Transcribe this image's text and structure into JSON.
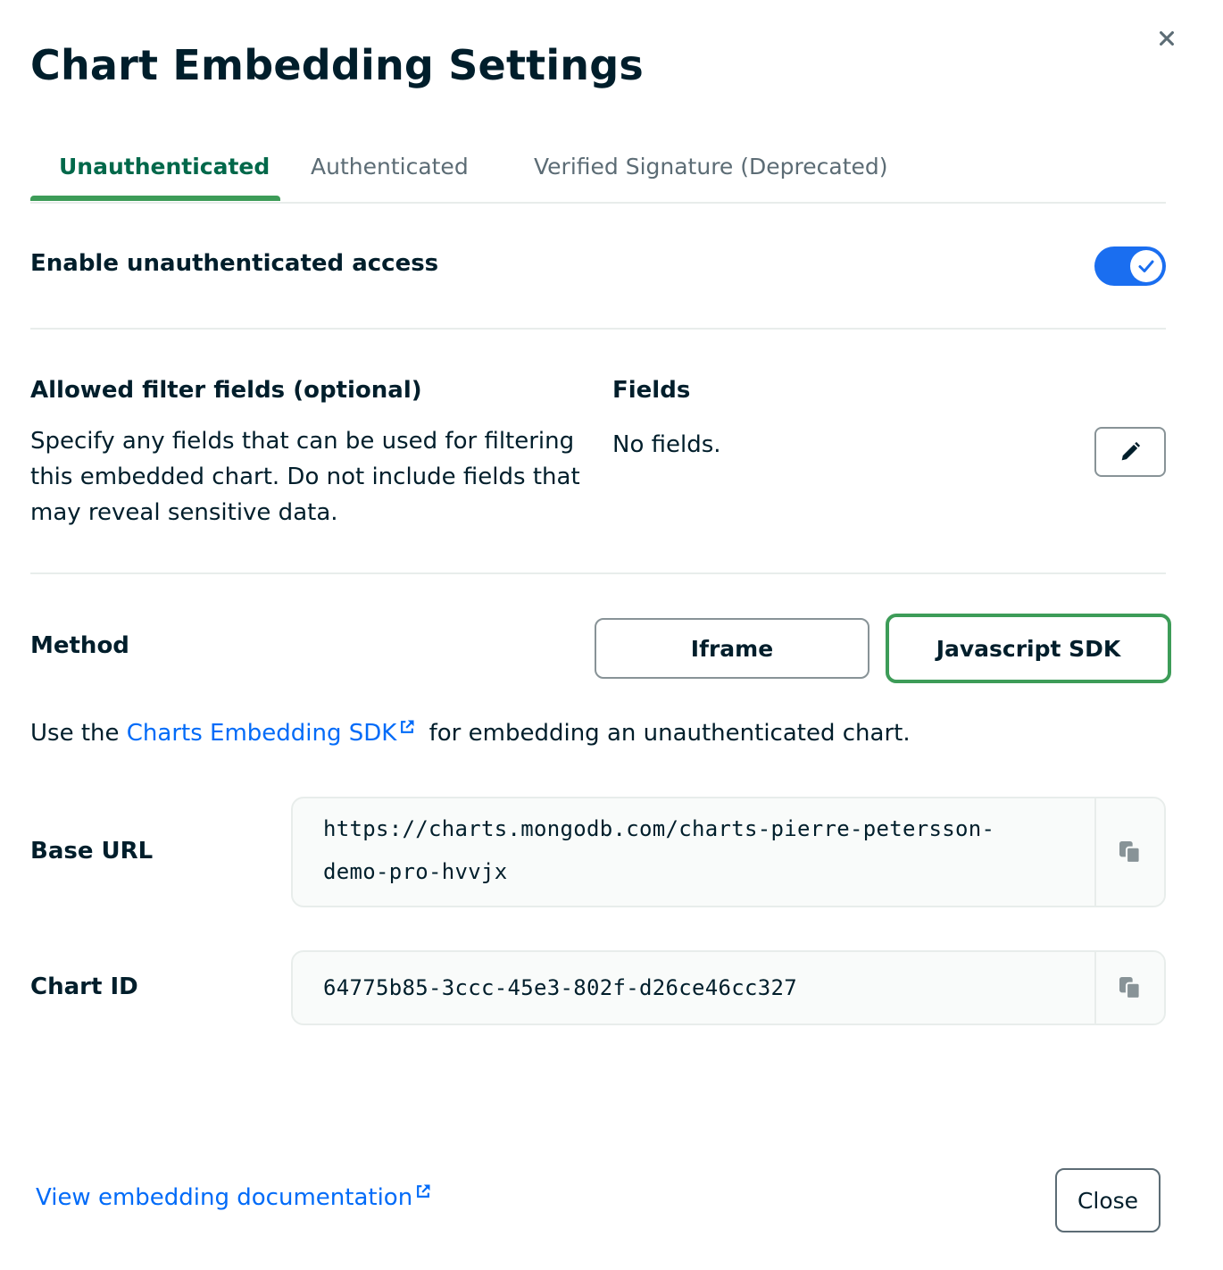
{
  "dialog": {
    "title": "Chart Embedding Settings",
    "close_icon": "close-icon"
  },
  "tabs": [
    {
      "label": "Unauthenticated",
      "active": true
    },
    {
      "label": "Authenticated",
      "active": false
    },
    {
      "label": "Verified Signature (Deprecated)",
      "active": false
    }
  ],
  "access": {
    "label": "Enable unauthenticated access",
    "enabled": true
  },
  "filters": {
    "heading": "Allowed filter fields (optional)",
    "description": "Specify any fields that can be used for filtering this embedded chart. Do not include fields that may reveal sensitive data.",
    "fields_heading": "Fields",
    "fields_value": "No fields.",
    "edit_icon": "pencil-icon"
  },
  "method": {
    "label": "Method",
    "options": [
      "Iframe",
      "Javascript SDK"
    ],
    "selected": "Javascript SDK"
  },
  "sdk_note": {
    "prefix": "Use the",
    "link": "Charts Embedding SDK",
    "suffix": "for embedding an unauthenticated chart."
  },
  "base_url": {
    "label": "Base URL",
    "value_line1": "https://charts.mongodb.com/charts-pierre-petersson-",
    "value_line2": "demo-pro-hvvjx"
  },
  "chart_id": {
    "label": "Chart ID",
    "value": "64775b85-3ccc-45e3-802f-d26ce46cc327"
  },
  "footer": {
    "doc_link": "View embedding documentation",
    "close_label": "Close"
  },
  "colors": {
    "accent_green": "#3d9c58",
    "tab_active_text": "#00684a",
    "toggle_blue": "#1a6ef0",
    "link_blue": "#016bf8"
  }
}
